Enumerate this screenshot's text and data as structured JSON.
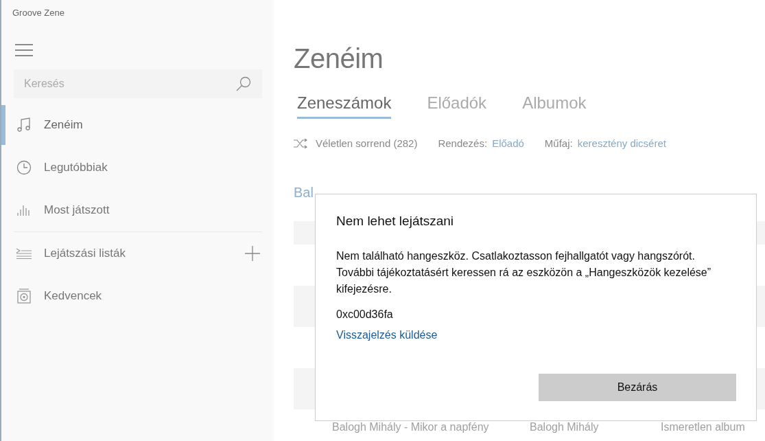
{
  "window": {
    "title": "Groove Zene"
  },
  "sidebar": {
    "search": {
      "placeholder": "Keresés"
    },
    "items": [
      {
        "label": "Zenéim",
        "kind": "music",
        "selected": true
      },
      {
        "label": "Legutóbbiak",
        "kind": "recent",
        "selected": false
      },
      {
        "label": "Most játszott",
        "kind": "now-playing",
        "selected": false
      },
      {
        "label": "Lejátszási listák",
        "kind": "playlists",
        "selected": false
      },
      {
        "label": "Kedvencek",
        "kind": "favorites",
        "selected": false
      }
    ]
  },
  "main": {
    "title": "Zenéim",
    "tabs": [
      {
        "label": "Zeneszámok",
        "selected": true
      },
      {
        "label": "Előadók",
        "selected": false
      },
      {
        "label": "Albumok",
        "selected": false
      }
    ],
    "toolbar": {
      "shuffle": "Véletlen sorrend (282)",
      "sort_label": "Rendezés:",
      "sort_value": "Előadó",
      "genre_label": "Műfaj:",
      "genre_value": "keresztény dicséret"
    },
    "list": {
      "group_header": "Bal",
      "rows": [
        {
          "title": "Balogh Mihály - Mikor a napfény",
          "artist": "Balogh Mihály",
          "album": "Ismeretlen album"
        }
      ]
    }
  },
  "dialog": {
    "title": "Nem lehet lejátszani",
    "message": "Nem található hangeszköz. Csatlakoztasson fejhallgatót vagy hangszórót. További tájékoztatásért keressen rá az eszközön a „Hangeszközök kezelése” kifejezésre.",
    "code": "0xc00d36fa",
    "link": "Visszajelzés küldése",
    "button": "Bezárás"
  }
}
